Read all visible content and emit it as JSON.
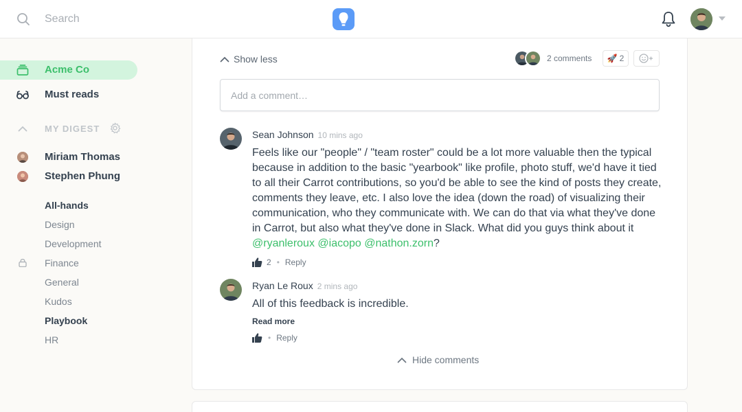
{
  "header": {
    "search_placeholder": "Search",
    "icons": [
      "search-icon",
      "carrot-logo",
      "bell-icon",
      "user-avatar",
      "caret-down-icon"
    ]
  },
  "sidebar": {
    "workspace": "Acme Co",
    "must_reads": "Must reads",
    "digest_label": "MY DIGEST",
    "people": [
      {
        "name": "Miriam Thomas"
      },
      {
        "name": "Stephen Phung"
      }
    ],
    "boards": [
      {
        "label": "All-hands",
        "bold": true
      },
      {
        "label": "Design",
        "bold": false
      },
      {
        "label": "Development",
        "bold": false
      },
      {
        "label": "Finance",
        "bold": false,
        "locked": true
      },
      {
        "label": "General",
        "bold": false
      },
      {
        "label": "Kudos",
        "bold": false
      },
      {
        "label": "Playbook",
        "bold": true
      },
      {
        "label": "HR",
        "bold": false
      }
    ]
  },
  "post": {
    "show_less": "Show less",
    "comments_count": "2 comments",
    "reaction": {
      "emoji": "🚀",
      "count": "2"
    },
    "comment_placeholder": "Add a comment…",
    "hide_comments": "Hide comments"
  },
  "comments": [
    {
      "author": "Sean Johnson",
      "time": "10 mins ago",
      "body": "Feels like our \"people\" / \"team roster\" could be a lot more valuable then the typical because in addition to the basic \"yearbook\" like profile, photo stuff, we'd have it tied to all their Carrot contributions, so you'd be able to see the kind of posts they create, comments they leave, etc. I also love the idea (down the road) of visualizing their communication, who they communicate with. We can do that via what they've done in Carrot, but also what they've done in Slack. What did you guys think about it",
      "mentions": [
        "@ryanleroux",
        "@iacopo",
        "@nathon.zorn"
      ],
      "trailing": "?",
      "likes": "2",
      "reply": "Reply"
    },
    {
      "author": "Ryan Le Roux",
      "time": "2 mins ago",
      "body": "All of this feedback is incredible.",
      "read_more": "Read more",
      "reply": "Reply"
    }
  ],
  "colors": {
    "accent": "#3cbf6b",
    "active_bg": "#d3f4de",
    "logo": "#5b9bf7"
  }
}
